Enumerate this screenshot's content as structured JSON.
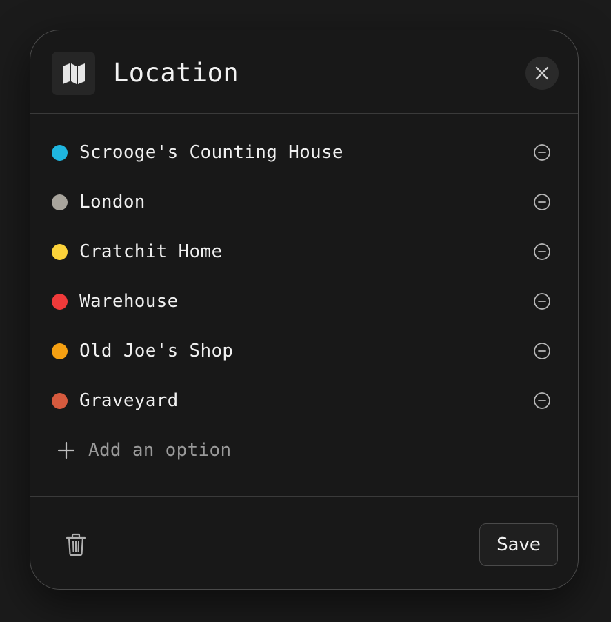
{
  "dialog": {
    "title": "Location",
    "header_icon": "map-icon",
    "close_icon": "close-icon"
  },
  "options": [
    {
      "label": "Scrooge's Counting House",
      "color": "#1fb6e0"
    },
    {
      "label": "London",
      "color": "#a8a49c"
    },
    {
      "label": "Cratchit Home",
      "color": "#fbd23a"
    },
    {
      "label": "Warehouse",
      "color": "#f03a3a"
    },
    {
      "label": "Old Joe's Shop",
      "color": "#f5a012"
    },
    {
      "label": "Graveyard",
      "color": "#d65a3e"
    }
  ],
  "add_option": {
    "label": "Add an option",
    "icon": "plus-icon"
  },
  "footer": {
    "delete_icon": "trash-icon",
    "save_label": "Save"
  }
}
